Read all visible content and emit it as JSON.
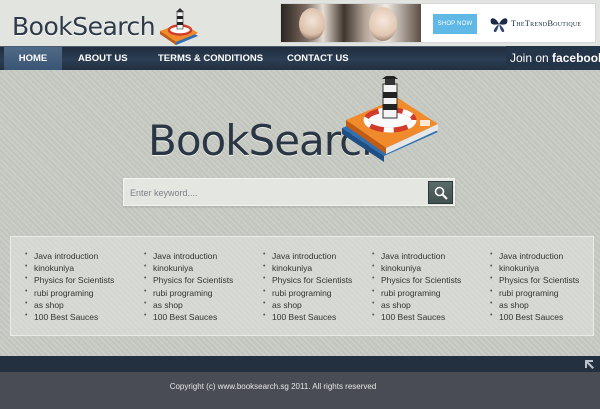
{
  "header": {
    "logo_text": "BookSearch",
    "ad": {
      "button_label": "SHOP NOW",
      "brand_name": "TheTrendBoutique"
    }
  },
  "nav": {
    "items": [
      {
        "label": "HOME",
        "active": true
      },
      {
        "label": "ABOUT US",
        "active": false
      },
      {
        "label": "TERMS & CONDITIONS",
        "active": false
      },
      {
        "label": "CONTACT US",
        "active": false
      }
    ],
    "facebook": {
      "prefix": "Join on",
      "brand": "facebook"
    }
  },
  "hero": {
    "logo_text": "BookSearch"
  },
  "search": {
    "placeholder": "Enter keyword....",
    "value": ""
  },
  "links": {
    "columns": [
      [
        "Java introduction",
        "kinokuniya",
        "Physics for Scientists",
        "rubi programing",
        "as shop",
        "100 Best Sauces"
      ],
      [
        "Java introduction",
        "kinokuniya",
        "Physics for Scientists",
        "rubi programing",
        "as shop",
        "100 Best Sauces"
      ],
      [
        "Java introduction",
        "kinokuniya",
        "Physics for Scientists",
        "rubi programing",
        "as shop",
        "100 Best Sauces"
      ],
      [
        "Java introduction",
        "kinokuniya",
        "Physics for Scientists",
        "rubi programing",
        "as shop",
        "100 Best Sauces"
      ],
      [
        "Java introduction",
        "kinokuniya",
        "Physics for Scientists",
        "rubi programing",
        "as shop",
        "100 Best Sauces"
      ]
    ]
  },
  "footer": {
    "copyright": "Copyright (c) www.booksearch.sg 2011. All rights reserved"
  },
  "colors": {
    "nav_bg": "#22303f",
    "nav_active": "#46607e",
    "search_button": "#4c5b5a",
    "footer_bg": "#494c52"
  }
}
